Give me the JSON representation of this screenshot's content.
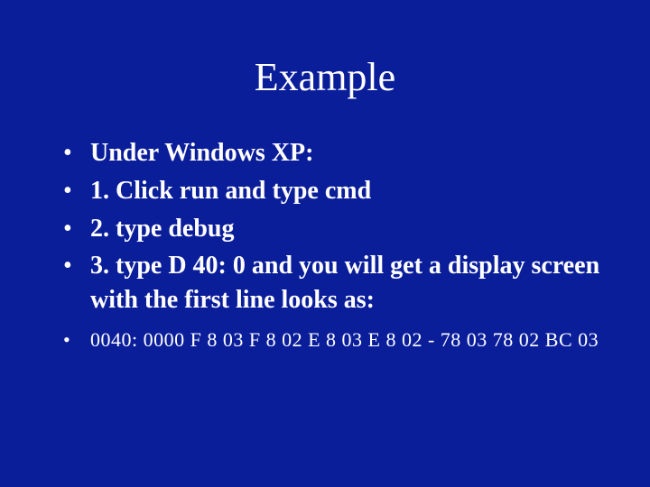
{
  "title": "Example",
  "items": [
    "Under Windows XP:",
    "1. Click run and type cmd",
    "2. type debug",
    "3. type D 40: 0 and you will get a display screen with the first line looks as:"
  ],
  "codeLine": "0040: 0000 F 8 03 F 8 02 E 8 03 E 8 02 - 78 03 78 02 BC 03"
}
